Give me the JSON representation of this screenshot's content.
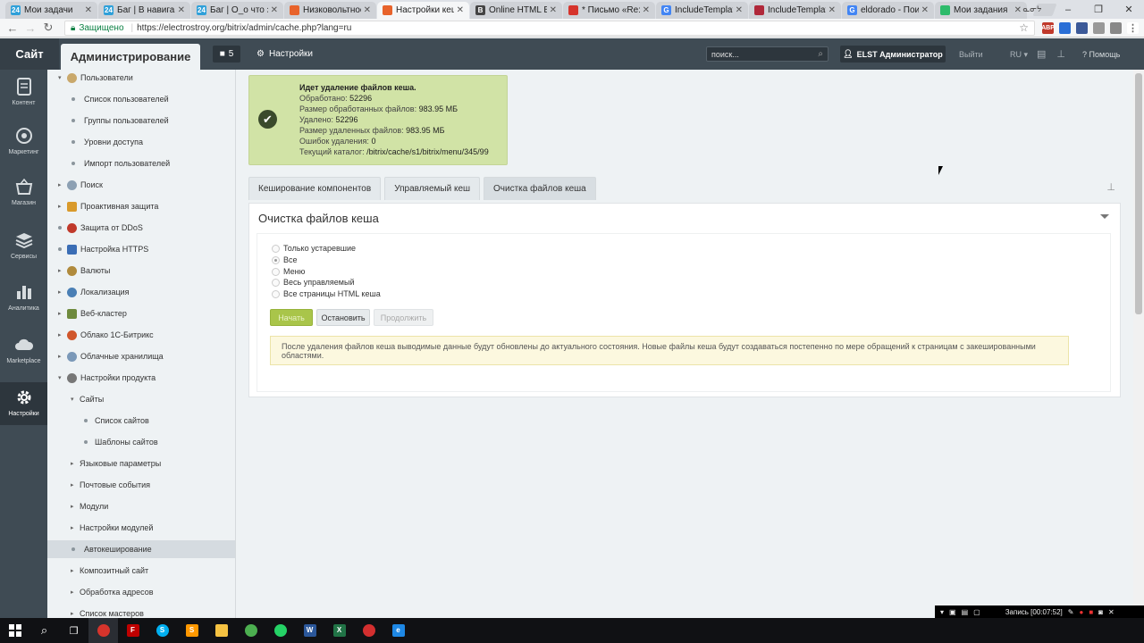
{
  "browser": {
    "tabs": [
      {
        "label": "Мои задачи",
        "fav": "24",
        "color": "#2fa0d9"
      },
      {
        "label": "Баг | В навигаци",
        "fav": "24",
        "color": "#2fa0d9"
      },
      {
        "label": "Баг | О_о что за",
        "fav": "24",
        "color": "#2fa0d9"
      },
      {
        "label": "Низковольтное",
        "fav": "",
        "color": "#e8632b"
      },
      {
        "label": "Настройки кеш",
        "fav": "",
        "color": "#e8632b",
        "active": true
      },
      {
        "label": "Online HTML Be",
        "fav": "B",
        "color": "#444"
      },
      {
        "label": "* Письмо «Re: Э",
        "fav": "",
        "color": "#d6342c"
      },
      {
        "label": "IncludeTemplate",
        "fav": "G",
        "color": "#4285f4"
      },
      {
        "label": "IncludeTemplate",
        "fav": "",
        "color": "#b0283a"
      },
      {
        "label": "eldorado - Поис",
        "fav": "G",
        "color": "#4285f4"
      },
      {
        "label": "Мои задания",
        "fav": "",
        "color": "#2dbb6b"
      }
    ],
    "user_label": "ᓇᓂᔭ",
    "secure_label": "Защищено",
    "url": "https://electrostroy.org/bitrix/admin/cache.php?lang=ru"
  },
  "panel": {
    "site_label": "Сайт",
    "admin_label": "Администрирование",
    "notif_count": "5",
    "settings_label": "Настройки",
    "search_placeholder": "поиск...",
    "user_label": "ELST Администратор",
    "exit_label": "Выйти",
    "lang_label": "RU",
    "help_label": "Помощь"
  },
  "rail": [
    {
      "label": "Контент",
      "icon": "content-icon"
    },
    {
      "label": "Маркетинг",
      "icon": "marketing-icon"
    },
    {
      "label": "Магазин",
      "icon": "shop-icon"
    },
    {
      "label": "Сервисы",
      "icon": "services-icon"
    },
    {
      "label": "Аналитика",
      "icon": "analytics-icon"
    },
    {
      "label": "Marketplace",
      "icon": "marketplace-icon"
    },
    {
      "label": "Настройки",
      "icon": "settings-icon",
      "active": true
    }
  ],
  "tree": [
    {
      "label": "Пользователи"
    },
    {
      "label": "Список пользователей"
    },
    {
      "label": "Группы пользователей"
    },
    {
      "label": "Уровни доступа"
    },
    {
      "label": "Импорт пользователей"
    },
    {
      "label": "Поиск"
    },
    {
      "label": "Проактивная защита"
    },
    {
      "label": "Защита от DDoS"
    },
    {
      "label": "Настройка HTTPS"
    },
    {
      "label": "Валюты"
    },
    {
      "label": "Локализация"
    },
    {
      "label": "Веб-кластер"
    },
    {
      "label": "Облако 1С-Битрикс"
    },
    {
      "label": "Облачные хранилища"
    },
    {
      "label": "Настройки продукта"
    },
    {
      "label": "Сайты"
    },
    {
      "label": "Список сайтов"
    },
    {
      "label": "Шаблоны сайтов"
    },
    {
      "label": "Языковые параметры"
    },
    {
      "label": "Почтовые события"
    },
    {
      "label": "Модули"
    },
    {
      "label": "Настройки модулей"
    },
    {
      "label": "Автокеширование"
    },
    {
      "label": "Композитный сайт"
    },
    {
      "label": "Обработка адресов"
    },
    {
      "label": "Список мастеров"
    }
  ],
  "notice": {
    "title": "Идет удаление файлов кеша.",
    "processed_label": "Обработано:",
    "processed": "52296",
    "size_processed_label": "Размер обработанных файлов:",
    "size_processed": "983.95 МБ",
    "deleted_label": "Удалено:",
    "deleted": "52296",
    "size_deleted_label": "Размер удаленных файлов:",
    "size_deleted": "983.95 МБ",
    "errors_label": "Ошибок удаления:",
    "errors": "0",
    "dir_label": "Текущий каталог:",
    "dir": "/bitrix/cache/s1/bitrix/menu/345/99"
  },
  "tabs": {
    "t1": "Кеширование компонентов",
    "t2": "Управляемый кеш",
    "t3": "Очистка файлов кеша"
  },
  "form": {
    "title": "Очистка файлов кеша",
    "options": [
      "Только устаревшие",
      "Все",
      "Меню",
      "Весь управляемый",
      "Все страницы HTML кеша"
    ],
    "selected_option": "Все",
    "start_label": "Начать",
    "stop_label": "Остановить",
    "continue_label": "Продолжить",
    "warning": "После удаления файлов кеша выводимые данные будут обновлены до актуального состояния. Новые файлы кеша будут создаваться постепенно по мере обращений к страницам с закешированными областями."
  },
  "taskbar": {
    "recording_label": "Запись [00:07:52]"
  }
}
